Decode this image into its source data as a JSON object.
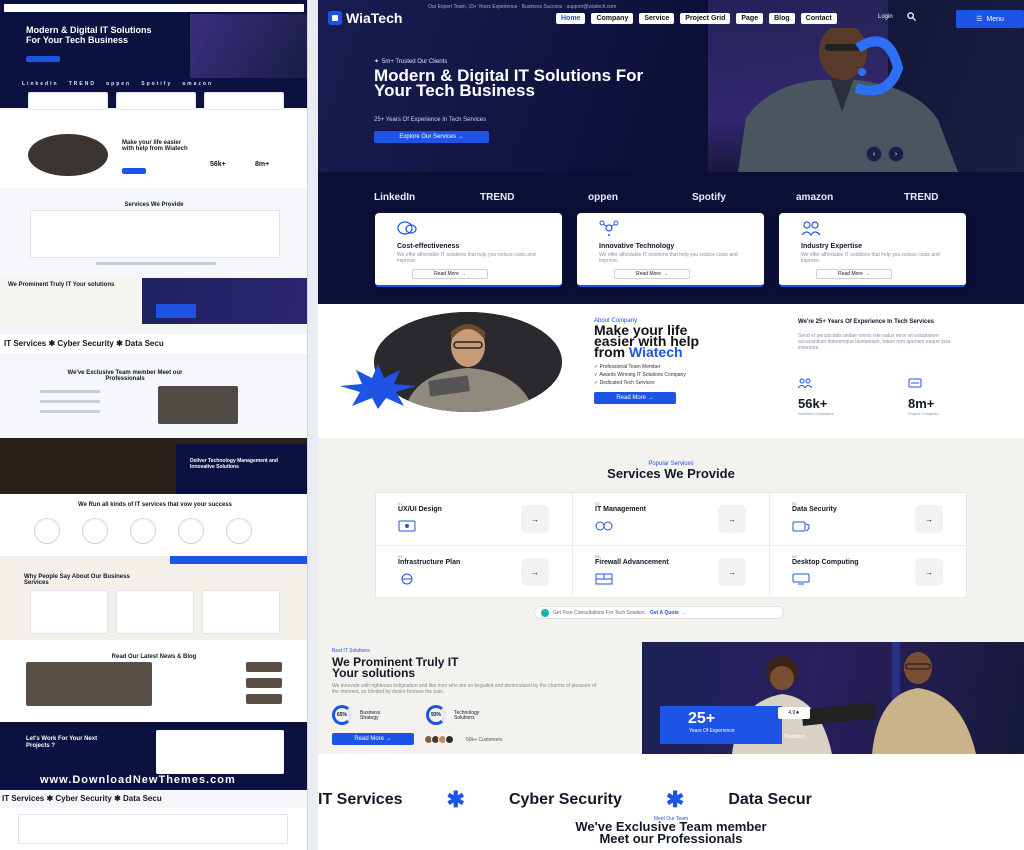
{
  "site": {
    "logo": "WiaTech",
    "topbar": "Our Expert Team, 15+ Years Experience · Business Success · support@wiatech.com"
  },
  "nav": {
    "items": [
      "Home",
      "Company",
      "Service",
      "Project Grid",
      "Page",
      "Blog",
      "Contact"
    ],
    "login": "Login",
    "menu_label": "Menu"
  },
  "hero": {
    "badge": "5m+ Trusted Our Clients",
    "title": "Modern & Digital IT Solutions For Your Tech Business",
    "subtitle": "25+ Years Of Experience In Tech Services",
    "button": "Explore Our Services →"
  },
  "brands": [
    "LinkedIn",
    "TREND",
    "oppen",
    "Spotify",
    "amazon",
    "TREND"
  ],
  "features": [
    {
      "title": "Cost-effectiveness",
      "desc": "We offer affordable IT solutions that help you reduce costs and improve.",
      "button": "Read More"
    },
    {
      "title": "Innovative Technology",
      "desc": "We offer affordable IT solutions that help you reduce costs and improve.",
      "button": "Read More"
    },
    {
      "title": "Industry Expertise",
      "desc": "We offer affordable IT solutions that help you reduce costs and improve.",
      "button": "Read More"
    }
  ],
  "about": {
    "badge": "About Company",
    "title_line1": "Make your life",
    "title_line2": "easier with help",
    "title_line3": "from ",
    "title_accent": "Wiatech",
    "list": [
      "Professional Team Member",
      "Awards Winning IT Solutions Company",
      "Dedicated Tech Services"
    ],
    "button": "Read More",
    "right_title": "We're 25+ Years Of Experience In Tech Services",
    "right_desc": "Send et perspiciatis undae omnis iste natus error sit voluptatem accusantium doloremque laudantium, totam rem aperiam eaque ipsa inventore.",
    "stats": [
      {
        "value": "56k+",
        "label": "Satisfied Customers"
      },
      {
        "value": "8m+",
        "label": "Project Complete"
      }
    ]
  },
  "services": {
    "badge": "Popular Services",
    "title": "Services We Provide",
    "items": [
      {
        "num": "01",
        "title": "UX/UI Design"
      },
      {
        "num": "02",
        "title": "IT Management"
      },
      {
        "num": "03",
        "title": "Data Security"
      },
      {
        "num": "04",
        "title": "Infrastructure Plan"
      },
      {
        "num": "05",
        "title": "Firewall Advancement"
      },
      {
        "num": "06",
        "title": "Desktop Computing"
      }
    ],
    "cta_text": "Get Free Consultations For Tech Solution.",
    "cta_link": "Get A Quote →"
  },
  "prominent": {
    "badge": "Best IT Solutions",
    "title_line1": "We Prominent Truly IT",
    "title_line2": "Your solutions",
    "desc": "We innovate with righteous indignation and like men who are so beguiled and demoralized by the charms of pleasure of the moment, so blinded by desire foresee the pain.",
    "rings": [
      {
        "value": "65%",
        "label1": "Business",
        "label2": "Strategy"
      },
      {
        "value": "93%",
        "label1": "Technology",
        "label2": "Solutions"
      }
    ],
    "button": "Read More →",
    "customers": "50k+ Customers",
    "badge_number": "25+",
    "badge_label": "Years Of Experience",
    "rating": "4.9★",
    "rating_label": "Trustpilot"
  },
  "marquee": [
    "IT Services",
    "Cyber Security",
    "Data Secur"
  ],
  "team": {
    "badge": "Meet Our Team",
    "title_line1": "We've Exclusive Team member",
    "title_line2": "Meet our Professionals"
  },
  "thumb": {
    "hero_title": "Modern & Digital IT Solutions For Your Tech Business",
    "about_title": "Make your life easier with help from Wiatech",
    "services_title": "Services We Provide",
    "prominent_title": "We Prominent Truly IT Your solutions",
    "marquee": "IT Services  ✱  Cyber Security  ✱  Data Secu",
    "team_title": "We've Exclusive Team member Meet our Professionals",
    "banner_title": "Deliver Technology Management and Innovative Solutions",
    "runall_title": "We Run all kinds of IT services that vow your success",
    "testimonial_title": "Why People Say About Our Business Services",
    "news_title": "Read Our Latest News & Blog",
    "work_title": "Let's Work For Your Next Projects ?",
    "watermark": "www.DownloadNewThemes.com",
    "marquee2": "IT Services  ✱  Cyber Security  ✱  Data Secu",
    "stats": [
      "56k+",
      "8m+"
    ]
  },
  "colors": {
    "accent": "#1e54e6",
    "navy": "#0b0f36",
    "sand": "#f4f2ee"
  }
}
